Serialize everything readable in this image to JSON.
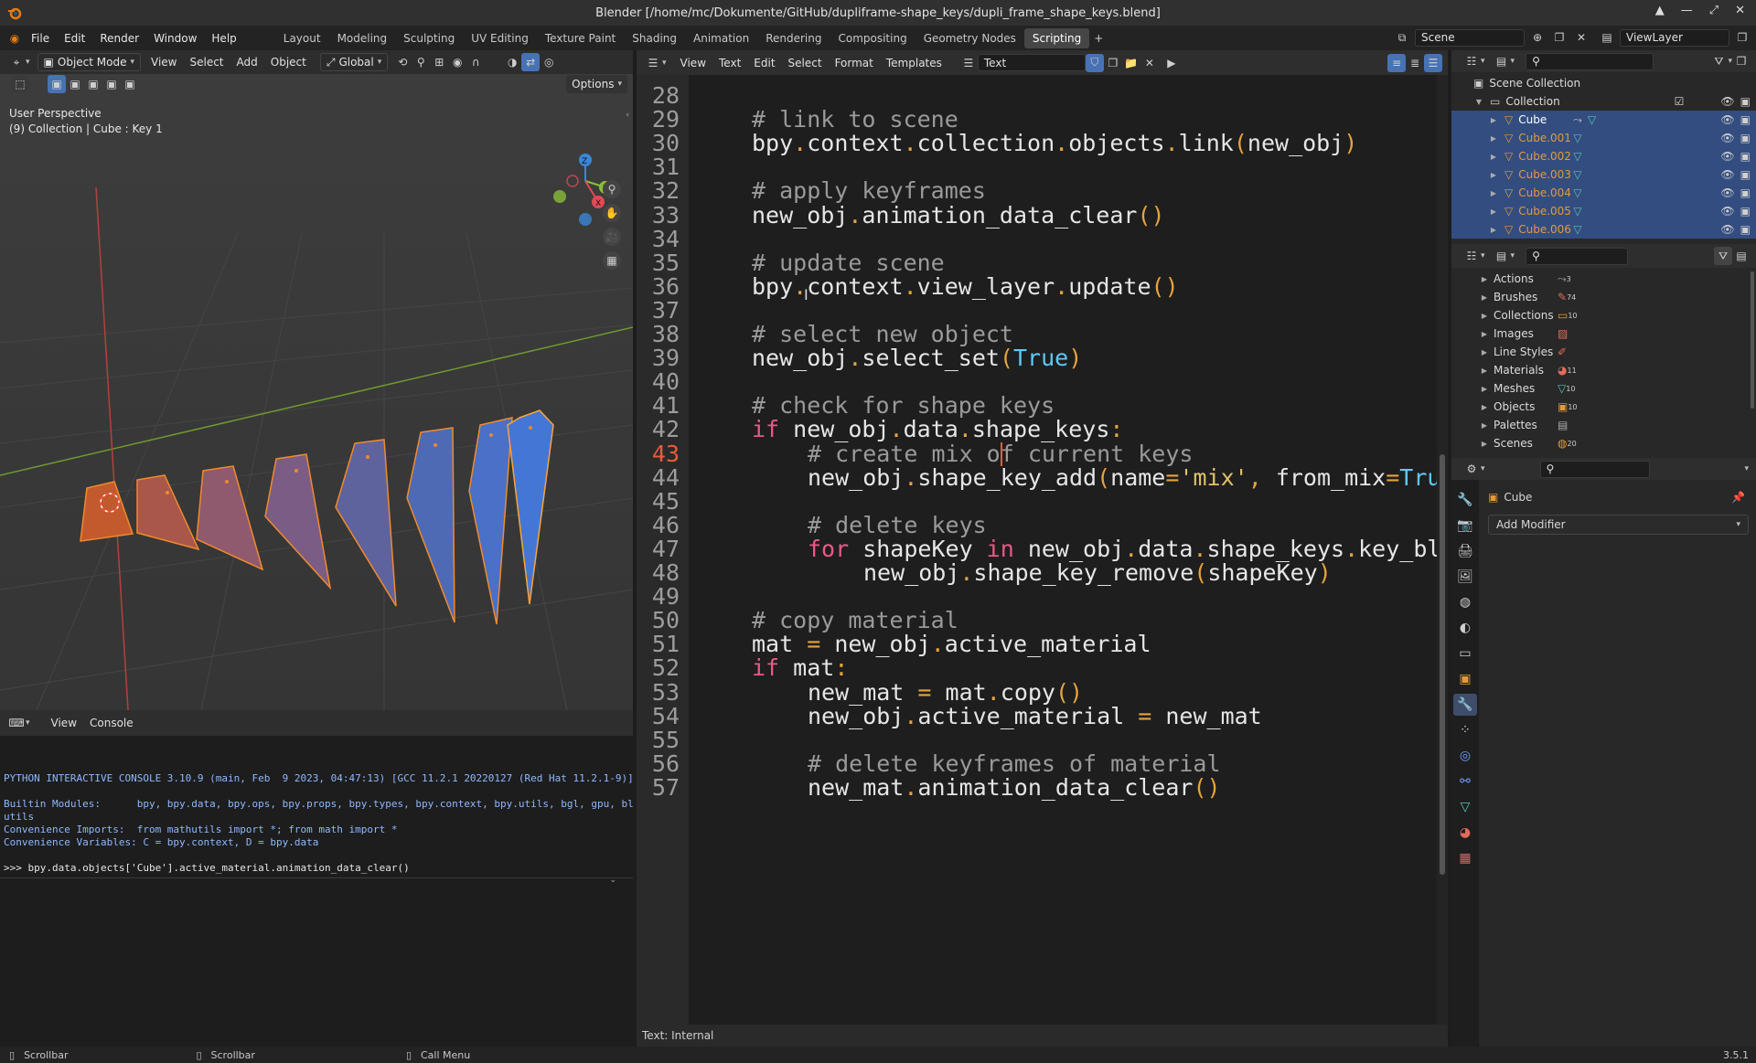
{
  "window": {
    "title": "Blender [/home/mc/Dokumente/GitHub/dupliframe-shape_keys/dupli_frame_shape_keys.blend]"
  },
  "menus": [
    "File",
    "Edit",
    "Render",
    "Window",
    "Help"
  ],
  "workspaces": [
    "Layout",
    "Modeling",
    "Sculpting",
    "UV Editing",
    "Texture Paint",
    "Shading",
    "Animation",
    "Rendering",
    "Compositing",
    "Geometry Nodes",
    "Scripting"
  ],
  "active_workspace": "Scripting",
  "scene_name": "Scene",
  "view_layer": "ViewLayer",
  "viewport": {
    "mode": "Object Mode",
    "menus": [
      "View",
      "Select",
      "Add",
      "Object"
    ],
    "orientation": "Global",
    "options": "Options",
    "overlay_title": "User Perspective",
    "overlay_sub": "(9) Collection | Cube : Key 1",
    "gizmo_axes": [
      "Z",
      "Y",
      "X"
    ]
  },
  "console": {
    "menus": [
      "View",
      "Console"
    ],
    "lines": [
      "PYTHON INTERACTIVE CONSOLE 3.10.9 (main, Feb  9 2023, 04:47:13) [GCC 11.2.1 20220127 (Red Hat 11.2.1-9)]",
      "",
      "Builtin Modules:      bpy, bpy.data, bpy.ops, bpy.props, bpy.types, bpy.context, bpy.utils, bgl, gpu, blf, math",
      "utils",
      "Convenience Imports:  from mathutils import *; from math import *",
      "Convenience Variables: C = bpy.context, D = bpy.data"
    ],
    "prompt": ">>> bpy.data.objects['Cube'].active_material.animation_data_clear()"
  },
  "editor": {
    "menus": [
      "View",
      "Text",
      "Edit",
      "Select",
      "Format",
      "Templates"
    ],
    "text_name": "Text",
    "footer": "Text: Internal",
    "current_line": 43,
    "lines": [
      {
        "n": 28,
        "indent": 0,
        "tokens": []
      },
      {
        "n": 29,
        "indent": 0,
        "tokens": [
          [
            "com",
            "# link to scene"
          ]
        ]
      },
      {
        "n": 30,
        "indent": 0,
        "tokens": [
          [
            "txt",
            "bpy"
          ],
          [
            "op",
            "."
          ],
          [
            "txt",
            "context"
          ],
          [
            "op",
            "."
          ],
          [
            "txt",
            "collection"
          ],
          [
            "op",
            "."
          ],
          [
            "txt",
            "objects"
          ],
          [
            "op",
            "."
          ],
          [
            "txt",
            "link"
          ],
          [
            "op",
            "("
          ],
          [
            "txt",
            "new_obj"
          ],
          [
            "op",
            ")"
          ]
        ]
      },
      {
        "n": 31,
        "indent": 0,
        "tokens": []
      },
      {
        "n": 32,
        "indent": 0,
        "tokens": [
          [
            "com",
            "# apply keyframes"
          ]
        ]
      },
      {
        "n": 33,
        "indent": 0,
        "tokens": [
          [
            "txt",
            "new_obj"
          ],
          [
            "op",
            "."
          ],
          [
            "txt",
            "animation_data_clear"
          ],
          [
            "op",
            "()"
          ]
        ]
      },
      {
        "n": 34,
        "indent": 0,
        "tokens": []
      },
      {
        "n": 35,
        "indent": 0,
        "tokens": [
          [
            "com",
            "# update scene"
          ]
        ]
      },
      {
        "n": 36,
        "indent": 0,
        "tokens": [
          [
            "txt",
            "bpy"
          ],
          [
            "op",
            "."
          ],
          [
            "txt",
            "context"
          ],
          [
            "op",
            "."
          ],
          [
            "txt",
            "view_layer"
          ],
          [
            "op",
            "."
          ],
          [
            "txt",
            "update"
          ],
          [
            "op",
            "()"
          ]
        ]
      },
      {
        "n": 37,
        "indent": 0,
        "tokens": []
      },
      {
        "n": 38,
        "indent": 0,
        "tokens": [
          [
            "com",
            "# select new object"
          ]
        ]
      },
      {
        "n": 39,
        "indent": 0,
        "tokens": [
          [
            "txt",
            "new_obj"
          ],
          [
            "op",
            "."
          ],
          [
            "txt",
            "select_set"
          ],
          [
            "op",
            "("
          ],
          [
            "bool",
            "True"
          ],
          [
            "op",
            ")"
          ]
        ]
      },
      {
        "n": 40,
        "indent": 0,
        "tokens": []
      },
      {
        "n": 41,
        "indent": 0,
        "tokens": [
          [
            "com",
            "# check for shape keys"
          ]
        ]
      },
      {
        "n": 42,
        "indent": 0,
        "tokens": [
          [
            "kw",
            "if"
          ],
          [
            "txt",
            " new_obj"
          ],
          [
            "op",
            "."
          ],
          [
            "txt",
            "data"
          ],
          [
            "op",
            "."
          ],
          [
            "txt",
            "shape_keys"
          ],
          [
            "op",
            ":"
          ]
        ]
      },
      {
        "n": 43,
        "indent": 1,
        "tokens": [
          [
            "com",
            "# create mix of current keys"
          ]
        ]
      },
      {
        "n": 44,
        "indent": 1,
        "tokens": [
          [
            "txt",
            "new_obj"
          ],
          [
            "op",
            "."
          ],
          [
            "txt",
            "shape_key_add"
          ],
          [
            "op",
            "("
          ],
          [
            "txt",
            "name"
          ],
          [
            "op",
            "="
          ],
          [
            "str",
            "'mix'"
          ],
          [
            "op",
            ","
          ],
          [
            "txt",
            " from_mix"
          ],
          [
            "op",
            "="
          ],
          [
            "bool",
            "True"
          ],
          [
            "op",
            ")"
          ]
        ]
      },
      {
        "n": 45,
        "indent": 0,
        "tokens": []
      },
      {
        "n": 46,
        "indent": 1,
        "tokens": [
          [
            "com",
            "# delete keys"
          ]
        ]
      },
      {
        "n": 47,
        "indent": 1,
        "tokens": [
          [
            "kw",
            "for"
          ],
          [
            "txt",
            " shapeKey "
          ],
          [
            "kw",
            "in"
          ],
          [
            "txt",
            " new_obj"
          ],
          [
            "op",
            "."
          ],
          [
            "txt",
            "data"
          ],
          [
            "op",
            "."
          ],
          [
            "txt",
            "shape_keys"
          ],
          [
            "op",
            "."
          ],
          [
            "txt",
            "key_blocks"
          ],
          [
            "op",
            ":"
          ]
        ]
      },
      {
        "n": 48,
        "indent": 2,
        "tokens": [
          [
            "txt",
            "new_obj"
          ],
          [
            "op",
            "."
          ],
          [
            "txt",
            "shape_key_remove"
          ],
          [
            "op",
            "("
          ],
          [
            "txt",
            "shapeKey"
          ],
          [
            "op",
            ")"
          ]
        ]
      },
      {
        "n": 49,
        "indent": 0,
        "tokens": []
      },
      {
        "n": 50,
        "indent": 0,
        "tokens": [
          [
            "com",
            "# copy material"
          ]
        ]
      },
      {
        "n": 51,
        "indent": 0,
        "tokens": [
          [
            "txt",
            "mat "
          ],
          [
            "op",
            "="
          ],
          [
            "txt",
            " new_obj"
          ],
          [
            "op",
            "."
          ],
          [
            "txt",
            "active_material"
          ]
        ]
      },
      {
        "n": 52,
        "indent": 0,
        "tokens": [
          [
            "kw",
            "if"
          ],
          [
            "txt",
            " mat"
          ],
          [
            "op",
            ":"
          ]
        ]
      },
      {
        "n": 53,
        "indent": 1,
        "tokens": [
          [
            "txt",
            "new_mat "
          ],
          [
            "op",
            "="
          ],
          [
            "txt",
            " mat"
          ],
          [
            "op",
            "."
          ],
          [
            "txt",
            "copy"
          ],
          [
            "op",
            "()"
          ]
        ]
      },
      {
        "n": 54,
        "indent": 1,
        "tokens": [
          [
            "txt",
            "new_obj"
          ],
          [
            "op",
            "."
          ],
          [
            "txt",
            "active_material "
          ],
          [
            "op",
            "="
          ],
          [
            "txt",
            " new_mat"
          ]
        ]
      },
      {
        "n": 55,
        "indent": 0,
        "tokens": []
      },
      {
        "n": 56,
        "indent": 1,
        "tokens": [
          [
            "com",
            "# delete keyframes of material"
          ]
        ]
      },
      {
        "n": 57,
        "indent": 1,
        "tokens": [
          [
            "txt",
            "new_mat"
          ],
          [
            "op",
            "."
          ],
          [
            "txt",
            "animation_data_clear"
          ],
          [
            "op",
            "()"
          ]
        ]
      }
    ]
  },
  "outliner": {
    "root": "Scene Collection",
    "collection": "Collection",
    "objects": [
      "Cube",
      "Cube.001",
      "Cube.002",
      "Cube.003",
      "Cube.004",
      "Cube.005",
      "Cube.006"
    ]
  },
  "datablocks": [
    {
      "name": "Actions",
      "count": "3"
    },
    {
      "name": "Brushes",
      "count": "74"
    },
    {
      "name": "Collections",
      "count": "10"
    },
    {
      "name": "Images",
      "count": ""
    },
    {
      "name": "Line Styles",
      "count": ""
    },
    {
      "name": "Materials",
      "count": "11"
    },
    {
      "name": "Meshes",
      "count": "10"
    },
    {
      "name": "Objects",
      "count": "10"
    },
    {
      "name": "Palettes",
      "count": ""
    },
    {
      "name": "Scenes",
      "count": "20"
    }
  ],
  "properties": {
    "object_name": "Cube",
    "add_modifier": "Add Modifier"
  },
  "statusbar": {
    "items": [
      "Scrollbar",
      "Scrollbar",
      "Call Menu"
    ],
    "version": "3.5.1"
  },
  "colors": {
    "accent_orange": "#e39a3b",
    "selection_blue": "#334d80",
    "comment": "#9a9a9a",
    "keyword": "#ea5a86",
    "operator": "#e6a33e",
    "string": "#e1c26b",
    "bool": "#5ec8f4",
    "current_line_number": "#e55d3c"
  }
}
